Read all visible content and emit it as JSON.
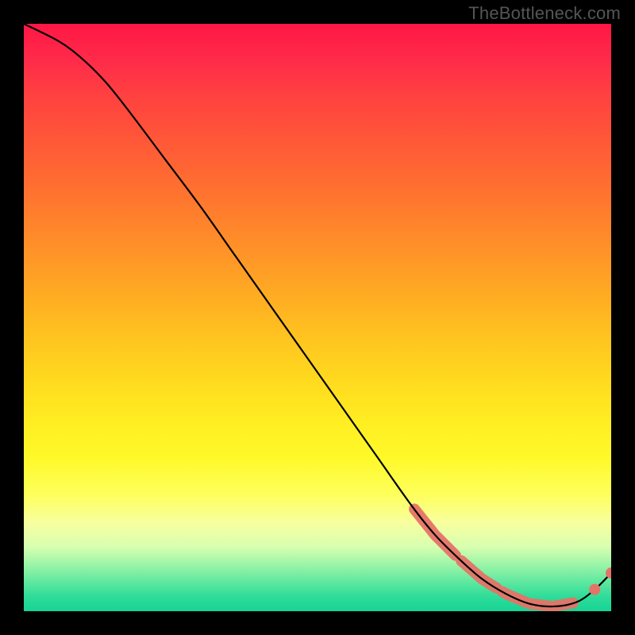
{
  "watermark": "TheBottleneck.com",
  "chart_data": {
    "type": "line",
    "title": "",
    "xlabel": "",
    "ylabel": "",
    "xlim": [
      0,
      100
    ],
    "ylim": [
      0,
      100
    ],
    "grid": false,
    "legend": false,
    "series": [
      {
        "name": "curve",
        "x": [
          0,
          6,
          10,
          14,
          18,
          24,
          30,
          36,
          42,
          48,
          54,
          60,
          66,
          70,
          74,
          78,
          82,
          86,
          90,
          94,
          97,
          100
        ],
        "values": [
          100,
          97,
          94,
          90,
          85,
          77,
          69,
          60.5,
          52,
          43.5,
          35,
          26.5,
          18,
          13,
          9,
          5.5,
          3,
          1.3,
          0.8,
          1.5,
          3.5,
          6.5
        ]
      }
    ],
    "highlight_segments": [
      {
        "x": [
          66.5,
          73.5
        ],
        "thickness": "thick"
      },
      {
        "x": [
          74.5,
          80.5
        ],
        "thickness": "thick"
      },
      {
        "x": [
          81.5,
          84.0
        ],
        "thickness": "thick"
      },
      {
        "x": [
          84.5,
          89.5
        ],
        "thickness": "thick"
      },
      {
        "x": [
          90.5,
          93.5
        ],
        "thickness": "thick"
      }
    ],
    "highlight_points": [
      {
        "x": 97.2,
        "y_follows_curve": true
      },
      {
        "x": 100,
        "y_follows_curve": true
      }
    ],
    "colors": {
      "curve": "#000000",
      "marker": "#e57368"
    }
  }
}
